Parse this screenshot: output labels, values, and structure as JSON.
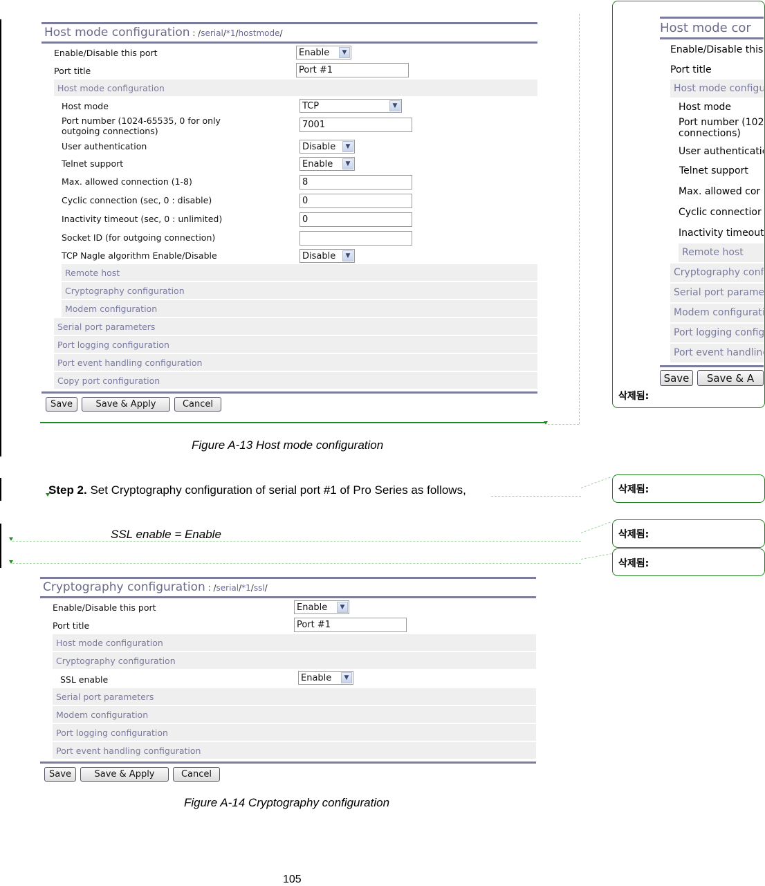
{
  "figure13": {
    "title": "Host mode configuration",
    "path_prefix": " : /",
    "path_segments": [
      "serial",
      "/",
      "*1",
      "/",
      "hostmode",
      "/"
    ],
    "rows": {
      "enable_label": "Enable/Disable this port",
      "enable_value": "Enable",
      "port_title_label": "Port title",
      "port_title_value": "Port #1",
      "host_mode_section": "Host mode configuration",
      "host_mode_label": "Host mode",
      "host_mode_value": "TCP",
      "port_number_label": "Port number (1024-65535, 0 for only outgoing connections)",
      "port_number_value": "7001",
      "user_auth_label": "User authentication",
      "user_auth_value": "Disable",
      "telnet_label": "Telnet support",
      "telnet_value": "Enable",
      "max_conn_label": "Max. allowed connection (1-8)",
      "max_conn_value": "8",
      "cyclic_label": "Cyclic connection (sec, 0 : disable)",
      "cyclic_value": "0",
      "inactivity_label": "Inactivity timeout (sec, 0 : unlimited)",
      "inactivity_value": "0",
      "socket_id_label": "Socket ID (for outgoing connection)",
      "socket_id_value": "",
      "nagle_label": "TCP Nagle algorithm Enable/Disable",
      "nagle_value": "Disable"
    },
    "sub_sections": [
      "Remote host",
      "Cryptography configuration",
      "Modem configuration"
    ],
    "sections": [
      "Serial port parameters",
      "Port logging configuration",
      "Port event handling configuration",
      "Copy port configuration"
    ],
    "buttons": {
      "save": "Save",
      "save_apply": "Save & Apply",
      "cancel": "Cancel"
    },
    "caption": "Figure A-13 Host mode configuration"
  },
  "step2": {
    "bold": "Step 2.",
    "text": " Set Cryptography configuration of serial port #1 of Pro Series as follows,"
  },
  "ssl_line": "SSL enable = Enable",
  "figure14": {
    "title": "Cryptography configuration",
    "path_prefix": " : /",
    "path_segments": [
      "serial",
      "/",
      "*1",
      "/",
      "ssl",
      "/"
    ],
    "rows": {
      "enable_label": "Enable/Disable this port",
      "enable_value": "Enable",
      "port_title_label": "Port title",
      "port_title_value": "Port #1",
      "host_mode_section": "Host mode configuration",
      "crypto_section": "Cryptography configuration",
      "ssl_label": "SSL enable",
      "ssl_value": "Enable"
    },
    "sections": [
      "Serial port parameters",
      "Modem configuration",
      "Port logging configuration",
      "Port event handling configuration"
    ],
    "buttons": {
      "save": "Save",
      "save_apply": "Save & Apply",
      "cancel": "Cancel"
    },
    "caption": "Figure A-14 Cryptography configuration"
  },
  "deleted_balloon": {
    "label": "삭제됨:",
    "mini_figure": {
      "title": "Host mode cor",
      "rows": [
        "Enable/Disable this",
        "Port title"
      ],
      "section": "Host mode configu",
      "sub_rows": [
        "Host mode",
        "Port number (102",
        "connections)",
        "User authenticatic",
        "Telnet support",
        "Max. allowed cor",
        "Cyclic connectior",
        "Inactivity timeout"
      ],
      "sub_section": "Remote host",
      "sections": [
        "Cryptography conf",
        "Serial port parame",
        "Modem configurati",
        "Port logging config",
        "Port event handling"
      ],
      "buttons": {
        "save": "Save",
        "save_apply": "Save & A"
      }
    }
  },
  "balloons": [
    "삭제됨:",
    "삭제됨:",
    "삭제됨:"
  ],
  "page_number": "105"
}
